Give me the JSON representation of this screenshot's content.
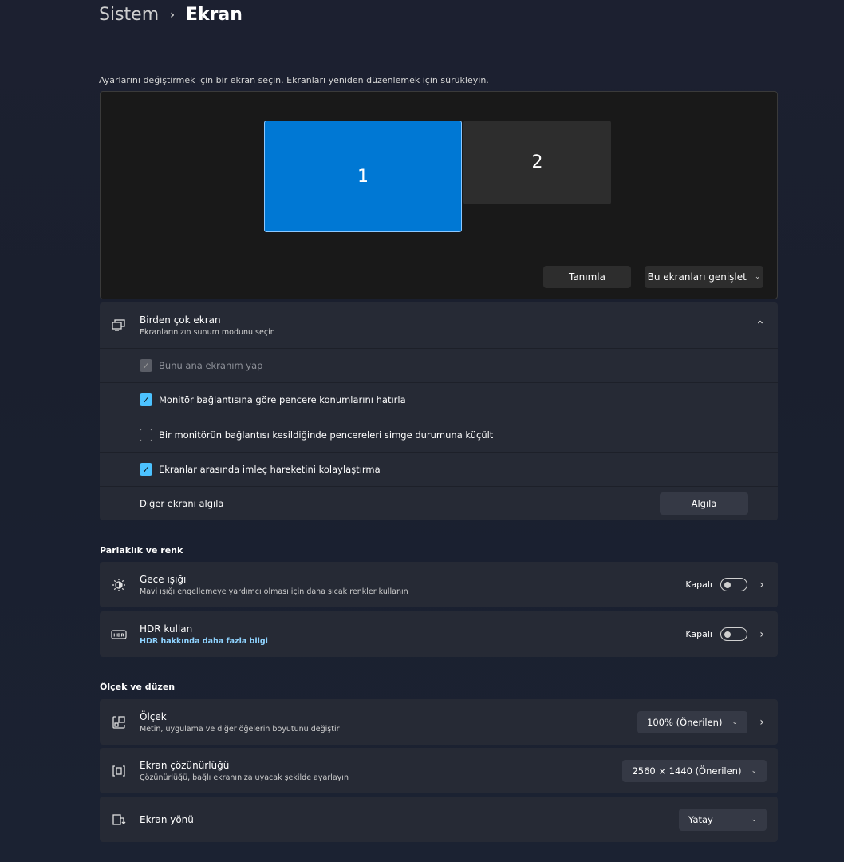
{
  "breadcrumb": {
    "parent": "Sistem",
    "separator": "›",
    "current": "Ekran"
  },
  "instructions": "Ayarlarını değiştirmek için bir ekran seçin. Ekranları yeniden düzenlemek için sürükleyin.",
  "arrange": {
    "monitor1": "1",
    "monitor2": "2",
    "identify_label": "Tanımla",
    "extend_label": "Bu ekranları genişlet"
  },
  "multi_display": {
    "title": "Birden çok ekran",
    "subtitle": "Ekranlarınızın sunum modunu seçin",
    "options": [
      {
        "label": "Bunu ana ekranım yap",
        "state": "checked-disabled"
      },
      {
        "label": "Monitör bağlantısına göre pencere konumlarını hatırla",
        "state": "checked"
      },
      {
        "label": "Bir monitörün bağlantısı kesildiğinde pencereleri simge durumuna küçült",
        "state": "unchecked"
      },
      {
        "label": "Ekranlar arasında imleç hareketini kolaylaştırma",
        "state": "checked"
      }
    ],
    "detect_label": "Diğer ekranı algıla",
    "detect_button": "Algıla"
  },
  "brightness": {
    "header": "Parlaklık ve renk",
    "night_light": {
      "title": "Gece ışığı",
      "subtitle": "Mavi ışığı engellemeye yardımcı olması için daha sıcak renkler kullanın",
      "state": "Kapalı"
    },
    "hdr": {
      "title": "HDR kullan",
      "link": "HDR hakkında daha fazla bilgi",
      "state": "Kapalı"
    }
  },
  "scale_layout": {
    "header": "Ölçek ve düzen",
    "scale": {
      "title": "Ölçek",
      "subtitle": "Metin, uygulama ve diğer öğelerin boyutunu değiştir",
      "value": "100% (Önerilen)"
    },
    "resolution": {
      "title": "Ekran çözünürlüğü",
      "subtitle": "Çözünürlüğü, bağlı ekranınıza uyacak şekilde ayarlayın",
      "value": "2560 × 1440 (Önerilen)"
    },
    "orientation": {
      "title": "Ekran yönü",
      "value": "Yatay"
    }
  },
  "colors": {
    "accent": "#0078d4",
    "checkbox": "#4cc2ff",
    "link": "#8fd3ff"
  }
}
